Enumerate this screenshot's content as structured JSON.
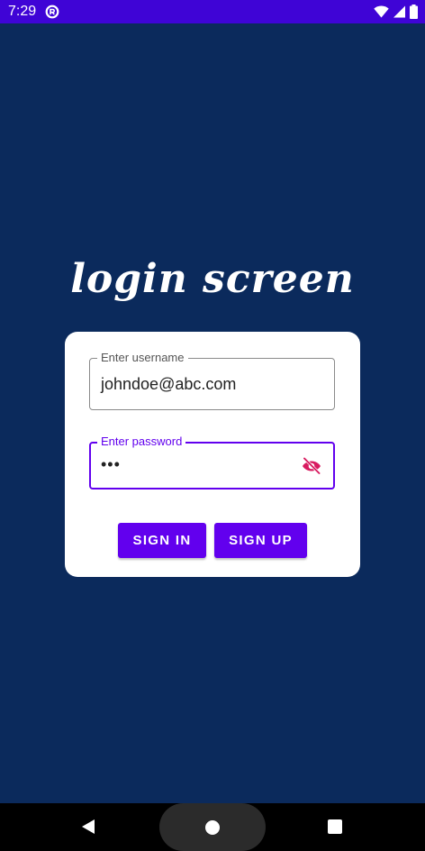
{
  "status_bar": {
    "time": "7:29",
    "app_icon": "circle-r-icon",
    "icons": [
      "wifi-icon",
      "cellular-signal-icon",
      "battery-icon"
    ]
  },
  "title": "login screen",
  "form": {
    "username": {
      "label": "Enter username",
      "value": "johndoe@abc.com"
    },
    "password": {
      "label": "Enter password",
      "value": "•••",
      "toggle_icon": "eye-off-icon"
    },
    "sign_in_label": "SIGN IN",
    "sign_up_label": "SIGN UP"
  },
  "nav_bar": {
    "icons": [
      "back-icon",
      "home-icon",
      "recents-icon"
    ]
  },
  "colors": {
    "status_bar": "#3f04d6",
    "background": "#0b2a5c",
    "accent": "#6200ee",
    "toggle_icon": "#d81b60"
  }
}
